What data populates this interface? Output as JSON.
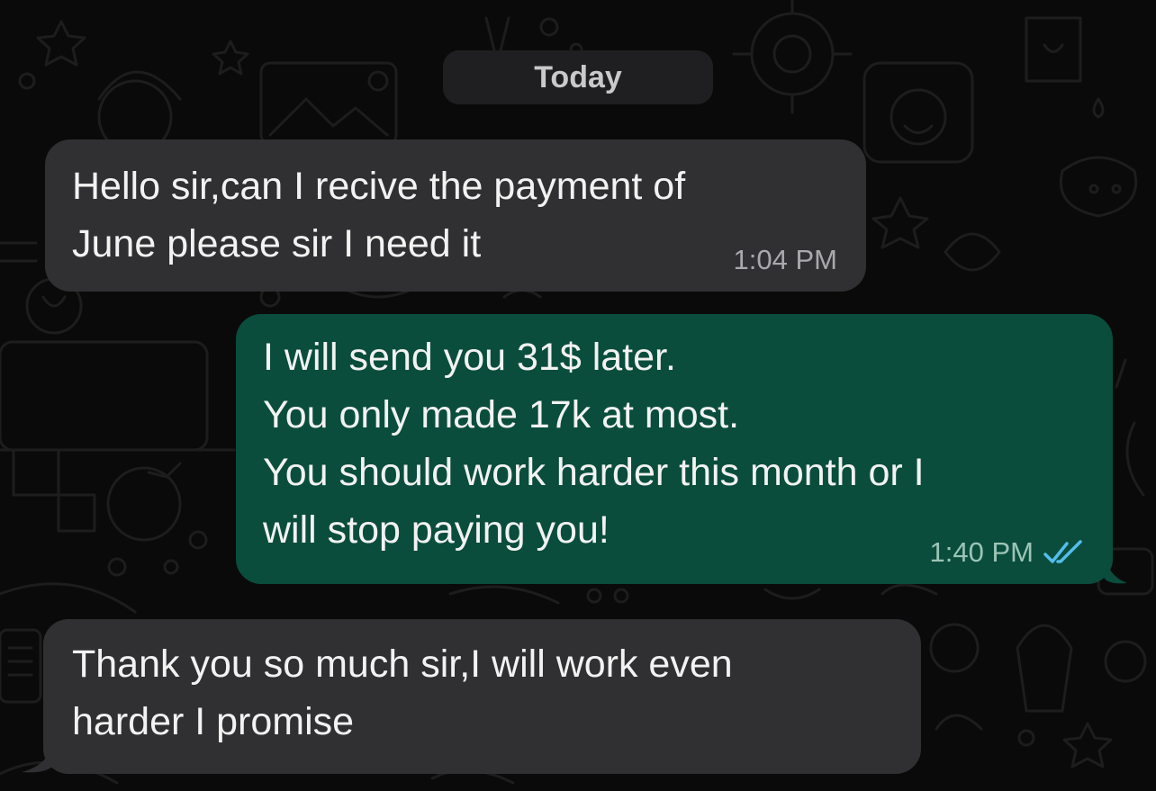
{
  "date_separator": "Today",
  "colors": {
    "background": "#0a0a0a",
    "incoming_bubble": "#303032",
    "outgoing_bubble": "#0a4d3c",
    "read_ticks": "#53bdeb"
  },
  "messages": [
    {
      "direction": "incoming",
      "text": "Hello sir,can I recive the payment of\nJune please sir I need it",
      "time": "1:04 PM"
    },
    {
      "direction": "outgoing",
      "text": "I will send you 31$ later.\nYou only made 17k at most.\nYou should work harder this month or I\nwill stop paying you!",
      "time": "1:40 PM",
      "status_icon": "double-check-read-icon"
    },
    {
      "direction": "incoming",
      "text": "Thank you so much sir,I will work even\nharder I promise",
      "time": ""
    }
  ]
}
